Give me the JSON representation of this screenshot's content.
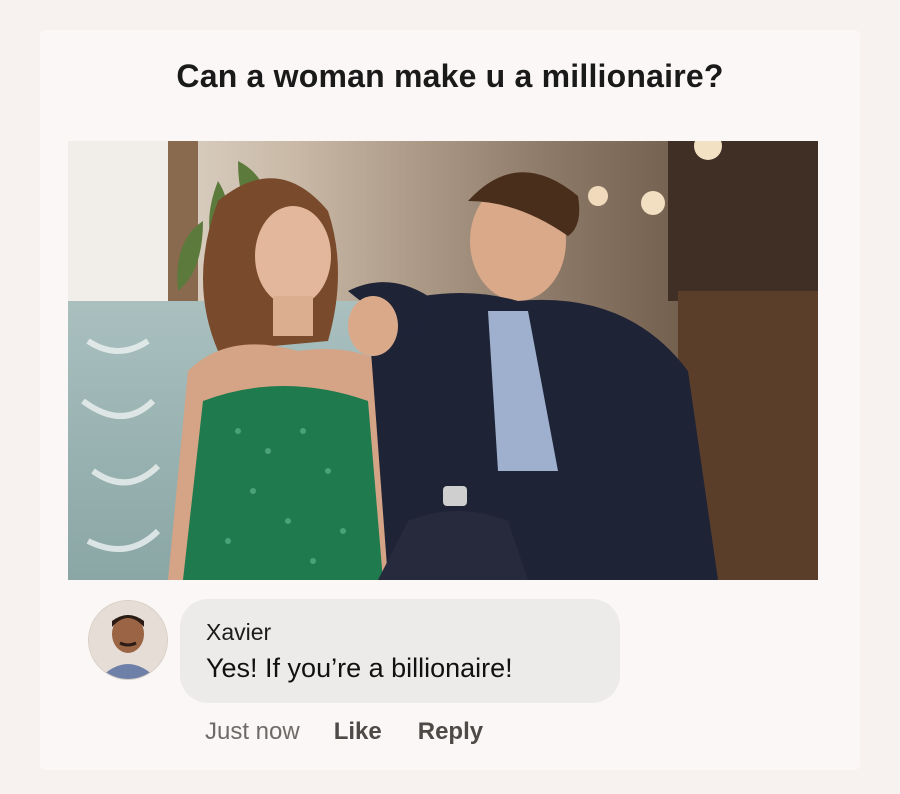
{
  "post": {
    "title": "Can a woman make u a millionaire?"
  },
  "photo": {
    "description_icon": "photo-image"
  },
  "comment": {
    "author": "Xavier",
    "text": "Yes! If you’re a billionaire!",
    "timestamp": "Just now",
    "like_label": "Like",
    "reply_label": "Reply"
  },
  "colors": {
    "background": "#f7f1f0",
    "bubble": "#ecebea",
    "meta_text": "#6d6a68"
  }
}
